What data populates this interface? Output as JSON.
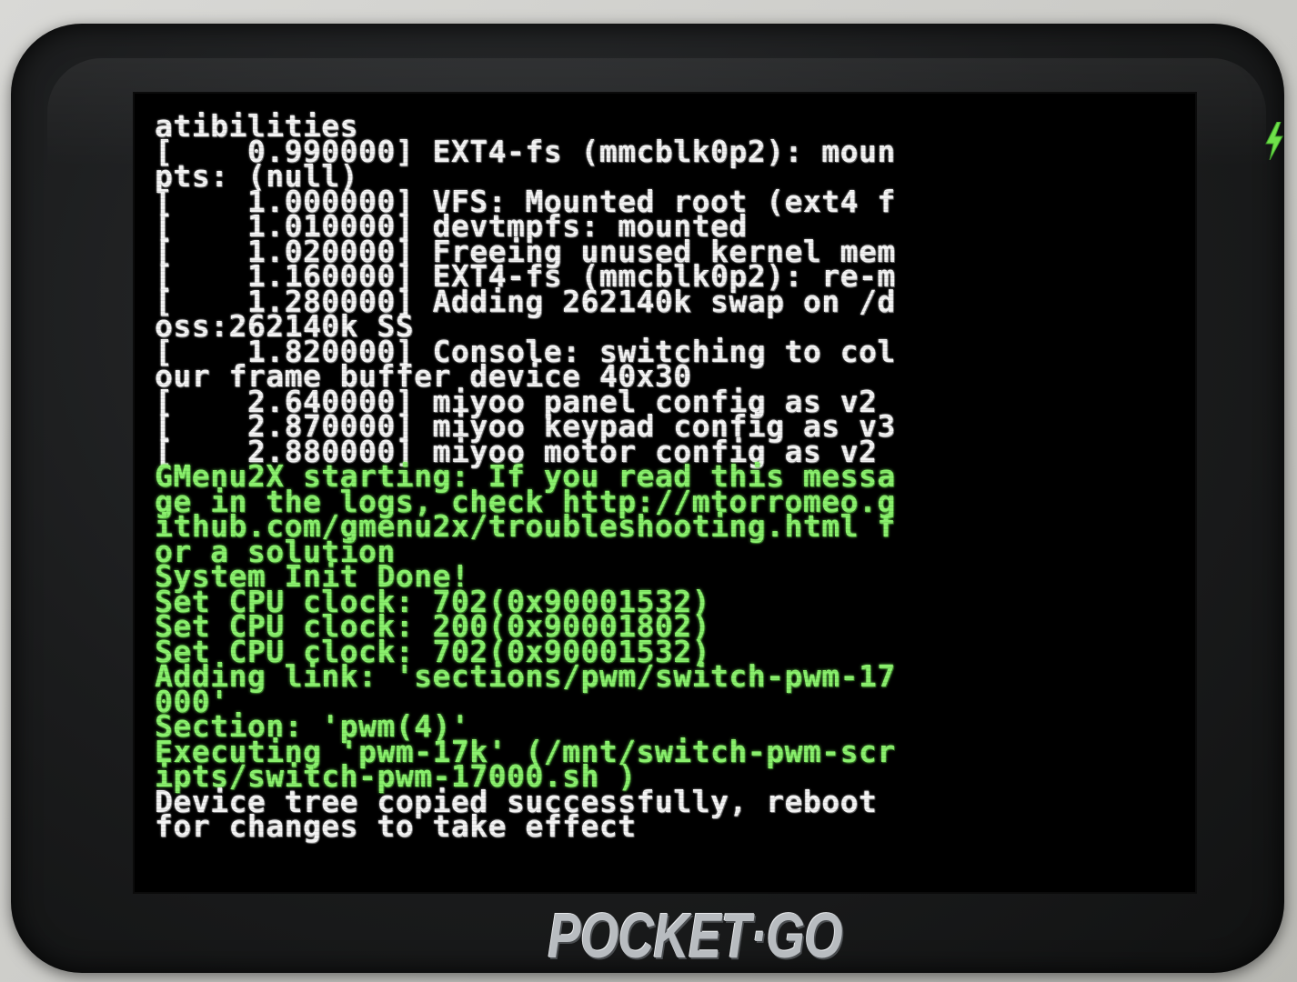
{
  "device": {
    "brand_logo": "POCKET·GO",
    "charge_indicator_icon": "lightning-bolt-icon",
    "charge_indicator_color": "#6fe04a"
  },
  "console": {
    "colors": {
      "kernel_text": "#f3f3f3",
      "gmenu_text": "#8af06d",
      "background": "#000000"
    },
    "lines": [
      {
        "text": "atibilities",
        "color": "white"
      },
      {
        "text": "[    0.990000] EXT4-fs (mmcblk0p2): moun",
        "color": "white"
      },
      {
        "text": "pts: (null)",
        "color": "white"
      },
      {
        "text": "[    1.000000] VFS: Mounted root (ext4 f",
        "color": "white"
      },
      {
        "text": "[    1.010000] devtmpfs: mounted",
        "color": "white"
      },
      {
        "text": "[    1.020000] Freeing unused kernel mem",
        "color": "white"
      },
      {
        "text": "[    1.160000] EXT4-fs (mmcblk0p2): re-m",
        "color": "white"
      },
      {
        "text": "[    1.280000] Adding 262140k swap on /d",
        "color": "white"
      },
      {
        "text": "oss:262140k SS",
        "color": "white"
      },
      {
        "text": "[    1.820000] Console: switching to col",
        "color": "white"
      },
      {
        "text": "our frame buffer device 40x30",
        "color": "white"
      },
      {
        "text": "[    2.640000] miyoo panel config as v2",
        "color": "white"
      },
      {
        "text": "[    2.870000] miyoo keypad config as v3",
        "color": "white"
      },
      {
        "text": "[    2.880000] miyoo motor config as v2",
        "color": "white"
      },
      {
        "text": "GMenu2X starting: If you read this messa",
        "color": "green"
      },
      {
        "text": "ge in the logs, check http://mtorromeo.g",
        "color": "green"
      },
      {
        "text": "ithub.com/gmenu2x/troubleshooting.html f",
        "color": "green"
      },
      {
        "text": "or a solution",
        "color": "green"
      },
      {
        "text": "System Init Done!",
        "color": "green"
      },
      {
        "text": "Set CPU clock: 702(0x90001532)",
        "color": "green"
      },
      {
        "text": "Set CPU clock: 200(0x90001802)",
        "color": "green"
      },
      {
        "text": "Set CPU clock: 702(0x90001532)",
        "color": "green"
      },
      {
        "text": "Adding link: 'sections/pwm/switch-pwm-17",
        "color": "green"
      },
      {
        "text": "000'",
        "color": "green"
      },
      {
        "text": "Section: 'pwm(4)'",
        "color": "green"
      },
      {
        "text": "Executing 'pwm-17k' (/mnt/switch-pwm-scr",
        "color": "green"
      },
      {
        "text": "ipts/switch-pwm-17000.sh )",
        "color": "green"
      },
      {
        "text": "Device tree copied successfully, reboot",
        "color": "white"
      },
      {
        "text": "for changes to take effect",
        "color": "white"
      }
    ]
  }
}
